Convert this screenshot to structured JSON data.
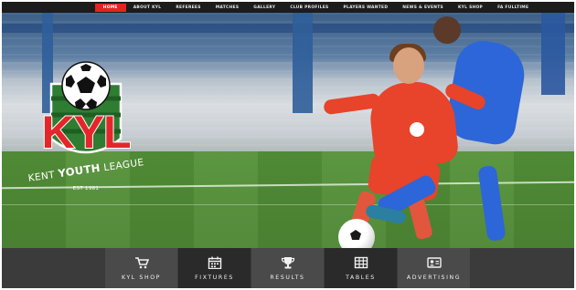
{
  "nav": {
    "items": [
      {
        "label": "HOME",
        "active": true
      },
      {
        "label": "ABOUT KYL"
      },
      {
        "label": "REFEREES"
      },
      {
        "label": "MATCHES"
      },
      {
        "label": "GALLERY"
      },
      {
        "label": "CLUB PROFILES"
      },
      {
        "label": "PLAYERS WANTED"
      },
      {
        "label": "NEWS & EVENTS"
      },
      {
        "label": "KYL SHOP"
      },
      {
        "label": "FA FULLTIME"
      }
    ],
    "active_color": "#e52420"
  },
  "logo": {
    "abbr": "KYL",
    "league_part1": "KENT ",
    "league_part2": "YOUTH",
    "league_part3": " LEAGUE",
    "est": "EST 1981",
    "colors": {
      "red": "#e4262b",
      "green": "#2e7d32"
    }
  },
  "tiles": [
    {
      "label": "KYL SHOP",
      "icon": "shopping-cart-icon"
    },
    {
      "label": "FIXTURES",
      "icon": "calendar-icon"
    },
    {
      "label": "RESULTS",
      "icon": "trophy-icon"
    },
    {
      "label": "TABLES",
      "icon": "table-grid-icon"
    },
    {
      "label": "ADVERTISING",
      "icon": "id-card-icon"
    }
  ]
}
